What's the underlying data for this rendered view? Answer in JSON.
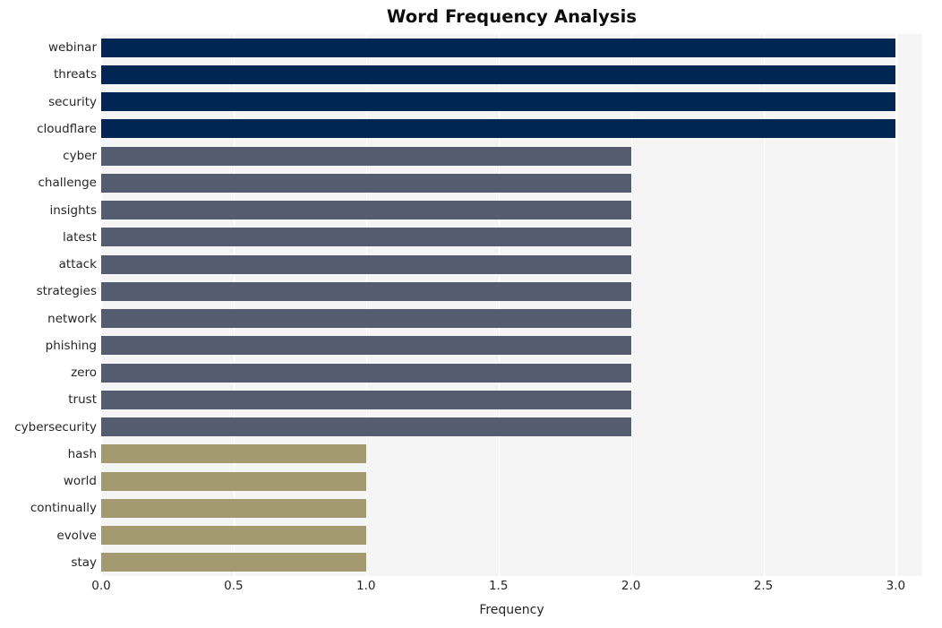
{
  "chart_data": {
    "type": "bar",
    "orientation": "horizontal",
    "title": "Word Frequency Analysis",
    "xlabel": "Frequency",
    "ylabel": "",
    "xlim": [
      0.0,
      3.1
    ],
    "xticks": [
      "0.0",
      "0.5",
      "1.0",
      "1.5",
      "2.0",
      "2.5",
      "3.0"
    ],
    "xtick_values": [
      0.0,
      0.5,
      1.0,
      1.5,
      2.0,
      2.5,
      3.0
    ],
    "grid": true,
    "legend": "none",
    "categories": [
      "webinar",
      "threats",
      "security",
      "cloudflare",
      "cyber",
      "challenge",
      "insights",
      "latest",
      "attack",
      "strategies",
      "network",
      "phishing",
      "zero",
      "trust",
      "cybersecurity",
      "hash",
      "world",
      "continually",
      "evolve",
      "stay"
    ],
    "values": [
      3,
      3,
      3,
      3,
      2,
      2,
      2,
      2,
      2,
      2,
      2,
      2,
      2,
      2,
      2,
      1,
      1,
      1,
      1,
      1
    ],
    "bar_colors": [
      "#022654",
      "#022654",
      "#022654",
      "#022654",
      "#555c70",
      "#555c70",
      "#555c70",
      "#555c70",
      "#555c70",
      "#555c70",
      "#555c70",
      "#555c70",
      "#555c70",
      "#555c70",
      "#555c70",
      "#a39a72",
      "#a39a72",
      "#a39a72",
      "#a39a72",
      "#a39a72"
    ]
  },
  "style": {
    "figure_background": "#ffffff",
    "plot_background": "#f5f5f6",
    "grid_color": "#ffffff",
    "text_color": "#262626",
    "title_color": "#0d0d0d",
    "color_high": "#022654",
    "color_mid": "#555c70",
    "color_low": "#a39a72"
  }
}
